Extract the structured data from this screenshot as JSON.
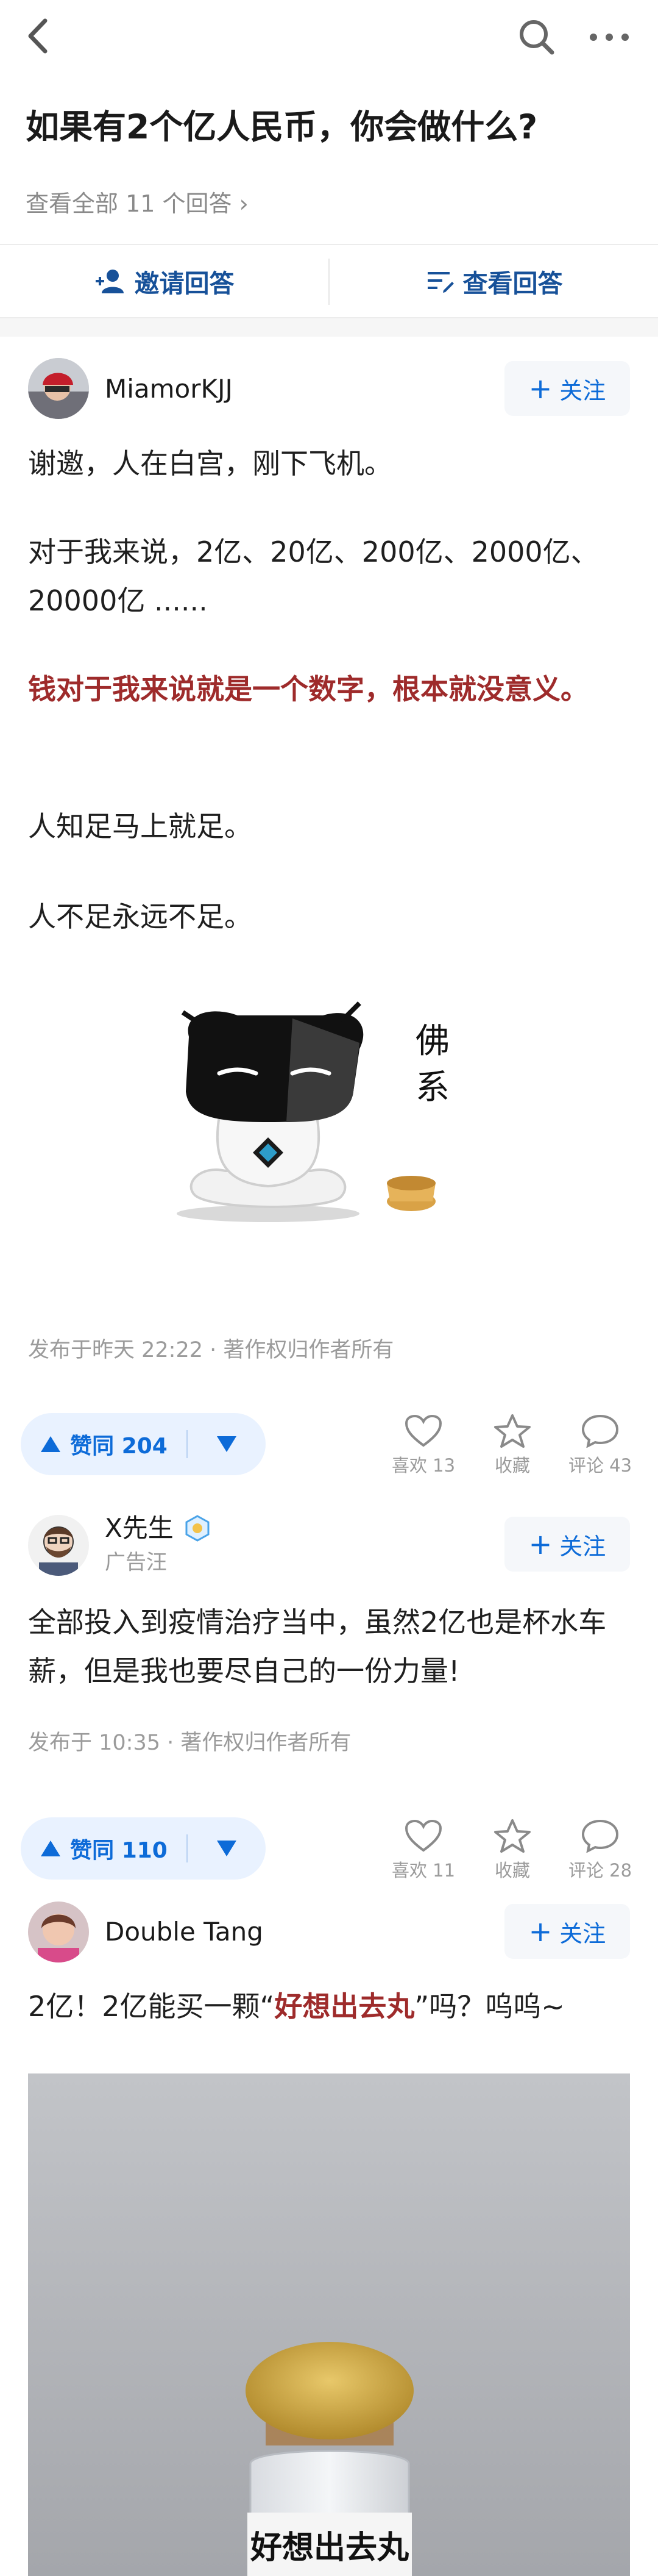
{
  "question": {
    "title": "如果有2个亿人民币，你会做什么?",
    "view_all": "查看全部 11 个回答 ›"
  },
  "actions": {
    "invite_label": "邀请回答",
    "view_label": "查看回答"
  },
  "colors": {
    "accent": "#0d6bd8",
    "highlight": "#9e2b2b",
    "muted": "#9b9b9b"
  },
  "answers": [
    {
      "author": "MiamorKJJ",
      "follow_label": "关注",
      "paragraphs": [
        "谢邀，人在白宫，刚下飞机。",
        "对于我来说，2亿、20亿、200亿、2000亿、20000亿 ......",
        "钱对于我来说就是一个数字，根本就没意义。",
        "人知足马上就足。",
        "人不足永远不足。"
      ],
      "sticker_caption": "佛系",
      "meta": "发布于昨天 22:22 · 著作权归作者所有",
      "vote_label": "赞同 204",
      "stats": {
        "like": "喜欢 13",
        "collect": "收藏",
        "comment": "评论 43"
      }
    },
    {
      "author": "X先生",
      "author_sub": "广告汪",
      "follow_label": "关注",
      "paragraphs": [
        "全部投入到疫情治疗当中，虽然2亿也是杯水车薪，但是我也要尽自己的一份力量!"
      ],
      "meta": "发布于 10:35 · 著作权归作者所有",
      "vote_label": "赞同 110",
      "stats": {
        "like": "喜欢 11",
        "collect": "收藏",
        "comment": "评论 28"
      }
    },
    {
      "author": "Double Tang",
      "follow_label": "关注",
      "text_before": "2亿！2亿能买一颗“",
      "text_highlight": "好想出去丸",
      "text_after": "”吗？呜呜~",
      "image_label": "好想出去丸"
    }
  ]
}
